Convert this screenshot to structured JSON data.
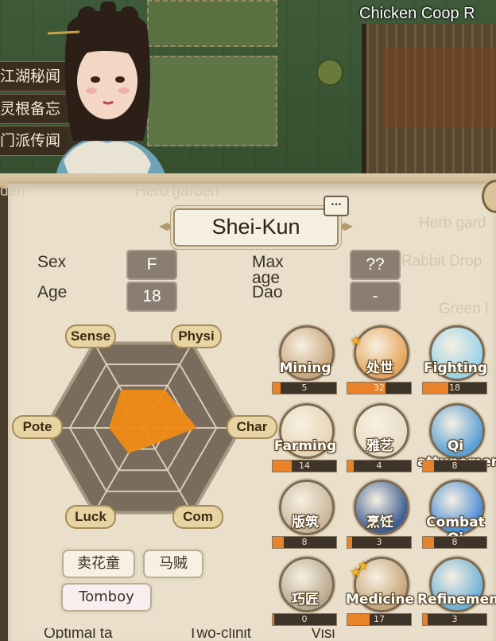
{
  "scene": {
    "building_label": "Chicken Coop  R",
    "side_tabs": [
      "江湖秘闻",
      "灵根备忘",
      "门派传闻"
    ]
  },
  "ghost_labels": [
    "Herb garden",
    "Herb gard",
    "Rabbit Drop",
    "Green l",
    "den"
  ],
  "character": {
    "name": "Shei-Kun",
    "stats": [
      {
        "label": "Sex",
        "value": "F"
      },
      {
        "label": "Age",
        "value": "18"
      },
      {
        "label": "Max age",
        "value": "??"
      },
      {
        "label": "Dao",
        "value": "-"
      }
    ]
  },
  "radar": {
    "axes": [
      "Sense",
      "Physi",
      "Char",
      "Com",
      "Luck",
      "Pote"
    ],
    "values": [
      0.45,
      0.45,
      0.55,
      0.2,
      0.3,
      0.35
    ],
    "fill_color": "#f08a14"
  },
  "tags": [
    "卖花童",
    "马贼",
    "Tomboy"
  ],
  "skills": [
    {
      "name": "Mining",
      "level": "5",
      "fill": 0.12,
      "icon": "pickaxe-icon",
      "color": "#c9a77d",
      "stars": 0
    },
    {
      "name": "处世",
      "level": "32",
      "fill": 0.6,
      "icon": "speech-bubble-icon",
      "color": "#e6a55a",
      "stars": 1
    },
    {
      "name": "Fighting",
      "level": "18",
      "fill": 0.4,
      "icon": "sword-icon",
      "color": "#9ad3ea",
      "stars": 0
    },
    {
      "name": "Farming",
      "level": "14",
      "fill": 0.3,
      "icon": "wheat-icon",
      "color": "#e6d6b4",
      "stars": 0
    },
    {
      "name": "雅艺",
      "level": "4",
      "fill": 0.1,
      "icon": "brush-icon",
      "color": "#e9dcc6",
      "stars": 0
    },
    {
      "name": "Qi attunement",
      "level": "8",
      "fill": 0.18,
      "icon": "wave-icon",
      "color": "#5a9fd6",
      "stars": 0
    },
    {
      "name": "版筑",
      "level": "8",
      "fill": 0.18,
      "icon": "pavilion-icon",
      "color": "#c8b69a",
      "stars": 0
    },
    {
      "name": "烹饪",
      "level": "3",
      "fill": 0.08,
      "icon": "cooking-icon",
      "color": "#3d5f94",
      "stars": 0
    },
    {
      "name": "Combat Qi",
      "level": "8",
      "fill": 0.18,
      "icon": "flame-icon",
      "color": "#4a8ed6",
      "stars": 0
    },
    {
      "name": "巧匠",
      "level": "0",
      "fill": 0.02,
      "icon": "hammer-icon",
      "color": "#b9a98e",
      "stars": 0
    },
    {
      "name": "Medicine",
      "level": "17",
      "fill": 0.35,
      "icon": "mortar-icon",
      "color": "#c7a679",
      "stars": 2
    },
    {
      "name": "Refinement",
      "level": "3",
      "fill": 0.08,
      "icon": "cauldron-icon",
      "color": "#6fb3d9",
      "stars": 0
    }
  ],
  "bottom_row": [
    "Optimal ta",
    "Two-clinit",
    "Visi"
  ]
}
